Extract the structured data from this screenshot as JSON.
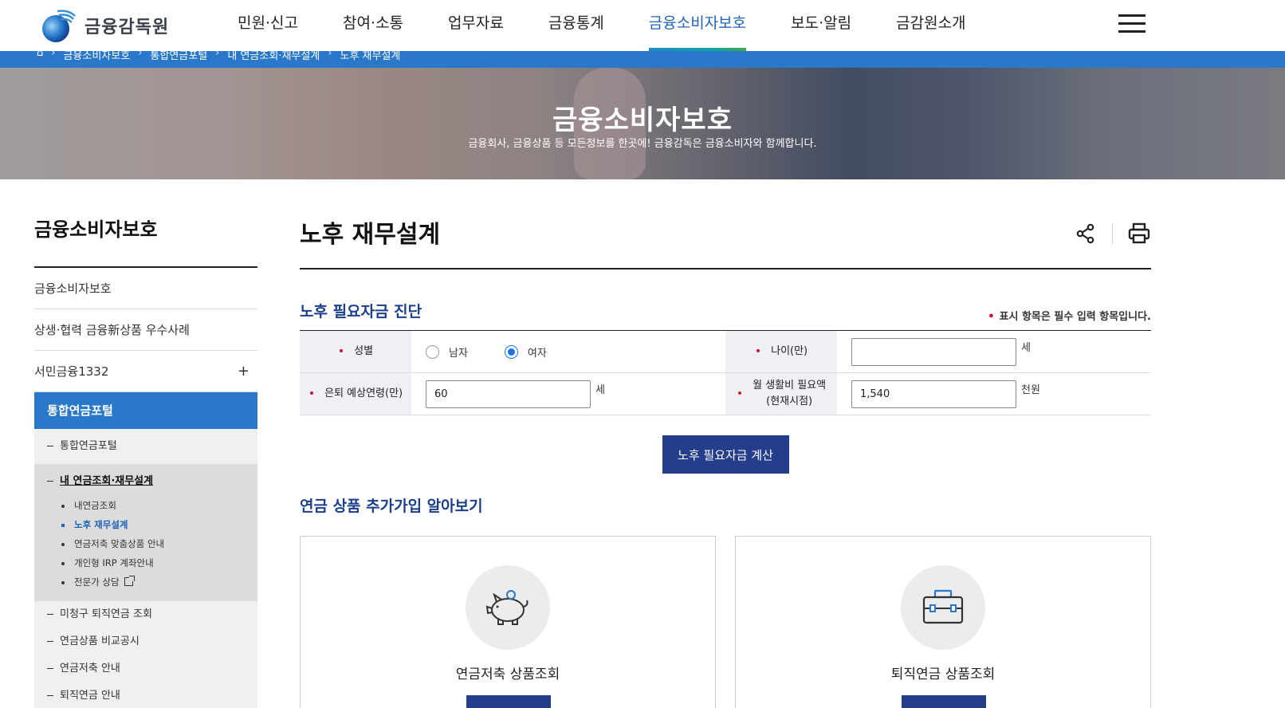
{
  "header": {
    "logo_text": "금융감독원",
    "nav": [
      {
        "label": "민원·신고"
      },
      {
        "label": "참여·소통"
      },
      {
        "label": "업무자료"
      },
      {
        "label": "금융통계"
      },
      {
        "label": "금융소비자보호",
        "active": true
      },
      {
        "label": "보도·알림"
      },
      {
        "label": "금감원소개"
      }
    ]
  },
  "breadcrumb": [
    "금융소비자보호",
    "통합연금포털",
    "내 연금조회·재무설계",
    "노후 재무설계"
  ],
  "hero": {
    "title": "금융소비자보호",
    "subtitle": "금융회사, 금융상품 등 모든정보를 한곳에! 금융감독은 금융소비자와 함께합니다."
  },
  "lnb": {
    "title": "금융소비자보호",
    "items": [
      "금융소비자보호",
      "상생·협력 금융新상품 우수사례",
      "서민금융1332"
    ],
    "plus": "+",
    "active": "통합연금포털",
    "sub_top": "통합연금포털",
    "open_group": "내 연금조회·재무설계",
    "open_children": [
      "내연금조회",
      "노후 재무설계",
      "연금저축 맞춤상품 안내",
      "개인형 IRP 계좌안내",
      "전문가 상담"
    ],
    "sub_after": [
      "미청구 퇴직연금 조회",
      "연금상품 비교공시",
      "연금저축 안내",
      "퇴직연금 안내"
    ]
  },
  "main": {
    "page_title": "노후 재무설계",
    "section1_title": "노후 필요자금 진단",
    "required_note": "표시 항목은 필수 입력 항목입니다.",
    "form": {
      "gender_label": "성별",
      "male": "남자",
      "female": "여자",
      "age_label": "나이(만)",
      "age_value": "",
      "age_unit": "세",
      "retire_label": "은퇴 예상연령(만)",
      "retire_value": "60",
      "retire_unit": "세",
      "living_label_1": "월 생활비 필요액",
      "living_label_2": "(현재시점)",
      "living_value": "1,540",
      "living_unit": "천원",
      "required_mark": "•"
    },
    "calc_button": "노후 필요자금 계산",
    "section2_title": "연금 상품 추가가입 알아보기",
    "cards": [
      {
        "label": "연금저축 상품조회",
        "icon": "piggy-bank-icon"
      },
      {
        "label": "퇴직연금 상품조회",
        "icon": "briefcase-icon"
      }
    ]
  },
  "colors": {
    "accent": "#2a78c9",
    "navy": "#243e8c",
    "title_blue": "#1b3f8b",
    "required": "#c8102e"
  }
}
